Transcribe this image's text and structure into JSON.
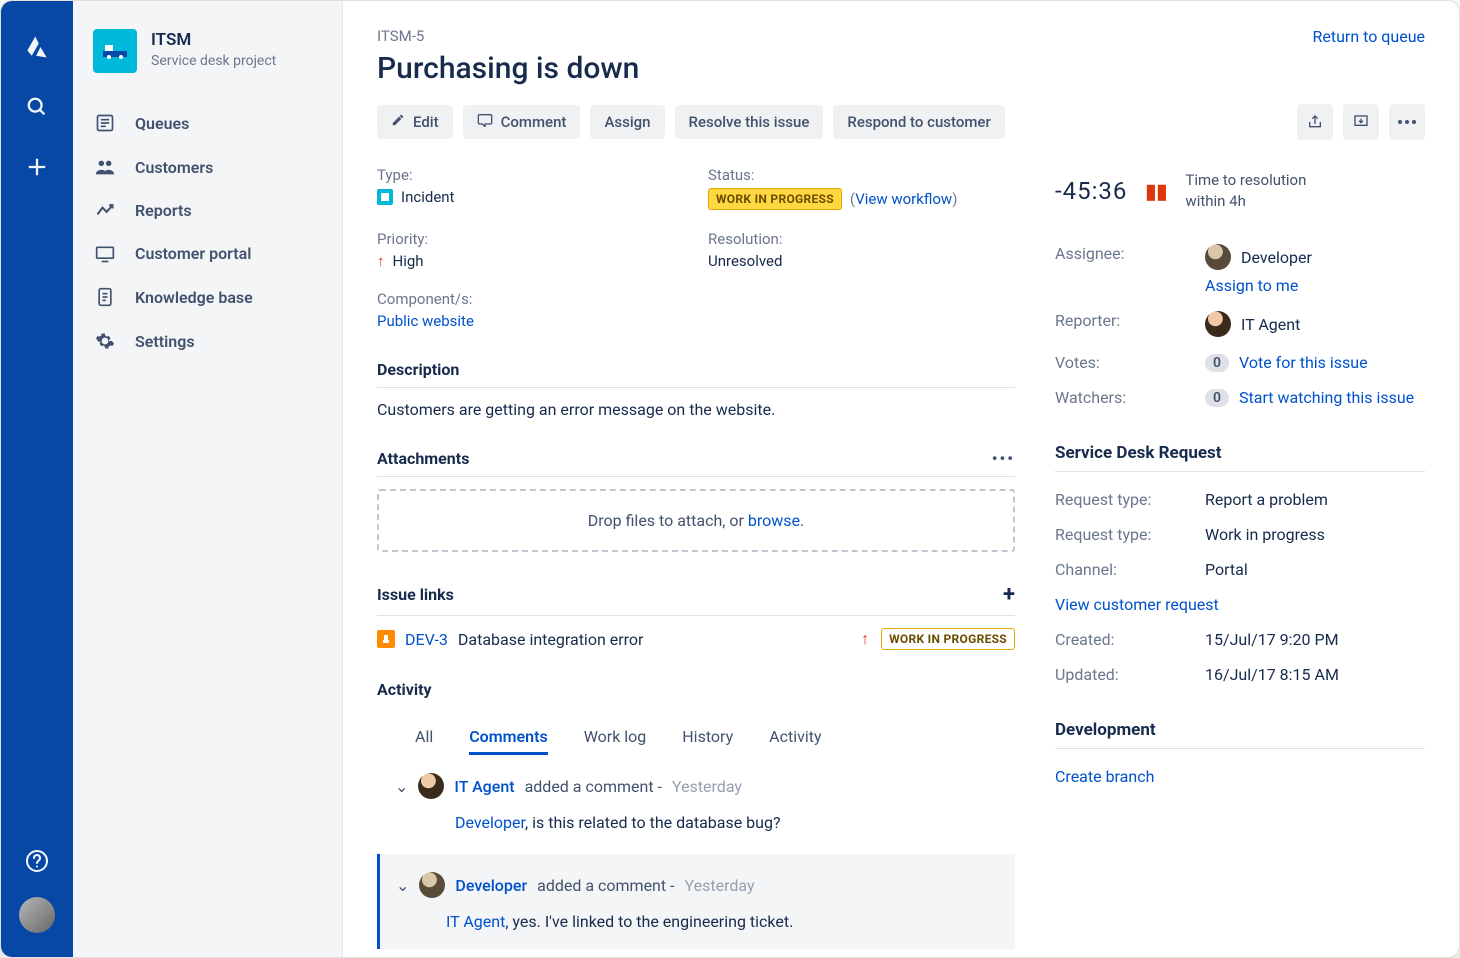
{
  "breadcrumb": "ITSM-5",
  "title": "Purchasing is down",
  "return_link": "Return to queue",
  "project": {
    "name": "ITSM",
    "subtitle": "Service desk project"
  },
  "sidebar_items": [
    {
      "label": "Queues"
    },
    {
      "label": "Customers"
    },
    {
      "label": "Reports"
    },
    {
      "label": "Customer portal"
    },
    {
      "label": "Knowledge base"
    },
    {
      "label": "Settings"
    }
  ],
  "actions": {
    "edit": "Edit",
    "comment": "Comment",
    "assign": "Assign",
    "resolve": "Resolve this issue",
    "respond": "Respond to customer"
  },
  "fields": {
    "type_label": "Type:",
    "type_value": "Incident",
    "status_label": "Status:",
    "status_lozenge": "WORK IN PROGRESS",
    "status_view_workflow": "View workflow",
    "priority_label": "Priority:",
    "priority_value": "High",
    "resolution_label": "Resolution:",
    "resolution_value": "Unresolved",
    "components_label": "Component/s:",
    "components_value": "Public website"
  },
  "description": {
    "heading": "Description",
    "body": "Customers are getting an error message on the website."
  },
  "attachments": {
    "heading": "Attachments",
    "drop_prefix": "Drop files to attach, or ",
    "browse": "browse",
    "drop_suffix": "."
  },
  "issue_links": {
    "heading": "Issue links",
    "items": [
      {
        "key": "DEV-3",
        "summary": "Database integration error",
        "status": "WORK IN PROGRESS"
      }
    ]
  },
  "activity": {
    "heading": "Activity",
    "tabs": {
      "all": "All",
      "comments": "Comments",
      "worklog": "Work log",
      "history": "History",
      "activity": "Activity"
    },
    "comments": [
      {
        "author": "IT Agent",
        "action": "added a comment -",
        "time": "Yesterday",
        "mention": "Developer",
        "body": ", is this related to the database bug?"
      },
      {
        "author": "Developer",
        "action": "added a comment -",
        "time": "Yesterday",
        "mention": "IT Agent",
        "body": ", yes. I've linked to the engineering ticket."
      }
    ]
  },
  "sla": {
    "time": "-45:36",
    "label1": "Time to resolution",
    "label2": "within 4h"
  },
  "people": {
    "assignee_label": "Assignee:",
    "assignee_value": "Developer",
    "assign_to_me": "Assign to me",
    "reporter_label": "Reporter:",
    "reporter_value": "IT Agent",
    "votes_label": "Votes:",
    "votes_count": "0",
    "votes_link": "Vote for this issue",
    "watchers_label": "Watchers:",
    "watchers_count": "0",
    "watchers_link": "Start watching this issue"
  },
  "sd": {
    "heading": "Service Desk Request",
    "rows": [
      {
        "label": "Request type:",
        "value": "Report a problem"
      },
      {
        "label": "Request type:",
        "value": "Work in progress"
      },
      {
        "label": "Channel:",
        "value": "Portal"
      }
    ],
    "view_link": "View customer request",
    "created_label": "Created:",
    "created_value": "15/Jul/17 9:20 PM",
    "updated_label": "Updated:",
    "updated_value": "16/Jul/17 8:15 AM"
  },
  "development": {
    "heading": "Development",
    "create_branch": "Create branch"
  }
}
